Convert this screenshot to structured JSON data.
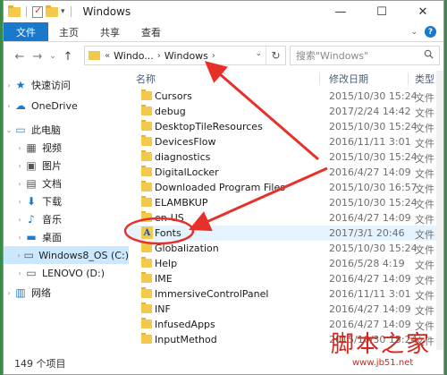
{
  "window": {
    "title": "Windows"
  },
  "ribbon": {
    "tabs": [
      {
        "label": "文件",
        "active": true
      },
      {
        "label": "主页",
        "active": false
      },
      {
        "label": "共享",
        "active": false
      },
      {
        "label": "查看",
        "active": false
      }
    ]
  },
  "address": {
    "prefix": "«",
    "segments": [
      "Windo...",
      "Windows"
    ],
    "search_placeholder": "搜索\"Windows\""
  },
  "nav": {
    "items": [
      {
        "label": "快速访问",
        "icon": "star-icon"
      },
      {
        "label": "OneDrive",
        "icon": "cloud-icon"
      },
      {
        "label": "此电脑",
        "icon": "computer-icon"
      },
      {
        "label": "视频",
        "icon": "video-icon"
      },
      {
        "label": "图片",
        "icon": "picture-icon"
      },
      {
        "label": "文档",
        "icon": "document-icon"
      },
      {
        "label": "下载",
        "icon": "download-icon"
      },
      {
        "label": "音乐",
        "icon": "music-icon"
      },
      {
        "label": "桌面",
        "icon": "desktop-icon"
      },
      {
        "label": "Windows8_OS (C:)",
        "icon": "drive-c-icon",
        "selected": true
      },
      {
        "label": "LENOVO (D:)",
        "icon": "drive-d-icon"
      },
      {
        "label": "网络",
        "icon": "network-icon"
      }
    ]
  },
  "columns": {
    "name": "名称",
    "date": "修改日期",
    "type": "类型"
  },
  "files": [
    {
      "name": "Cursors",
      "date": "2015/10/30 15:24",
      "type": "文件"
    },
    {
      "name": "debug",
      "date": "2017/2/24 14:42",
      "type": "文件"
    },
    {
      "name": "DesktopTileResources",
      "date": "2015/10/30 15:24",
      "type": "文件"
    },
    {
      "name": "DevicesFlow",
      "date": "2016/11/11 3:01",
      "type": "文件"
    },
    {
      "name": "diagnostics",
      "date": "2015/10/30 15:24",
      "type": "文件"
    },
    {
      "name": "DigitalLocker",
      "date": "2016/4/27 14:09",
      "type": "文件"
    },
    {
      "name": "Downloaded Program Files",
      "date": "2015/10/30 16:57",
      "type": "文件"
    },
    {
      "name": "ELAMBKUP",
      "date": "2015/10/30 15:24",
      "type": "文件"
    },
    {
      "name": "en-US",
      "date": "2016/4/27 14:09",
      "type": "文件"
    },
    {
      "name": "Fonts",
      "date": "2017/3/1 20:46",
      "type": "文件",
      "highlight": true
    },
    {
      "name": "Globalization",
      "date": "2015/10/30 15:24",
      "type": "文件"
    },
    {
      "name": "Help",
      "date": "2016/5/28 4:19",
      "type": "文件"
    },
    {
      "name": "IME",
      "date": "2016/4/27 14:09",
      "type": "文件"
    },
    {
      "name": "ImmersiveControlPanel",
      "date": "2016/11/11 3:01",
      "type": "文件"
    },
    {
      "name": "INF",
      "date": "2016/4/27 14:09",
      "type": "文件"
    },
    {
      "name": "InfusedApps",
      "date": "2016/4/27 14:09",
      "type": "文件"
    },
    {
      "name": "InputMethod",
      "date": "2015/10/30 15:24",
      "type": "文件"
    }
  ],
  "status": {
    "count": "149 个项目"
  },
  "watermark": {
    "text": "脚本之家",
    "url": "www.jb51.net"
  },
  "colors": {
    "accent": "#1979ca",
    "annotation": "#e8302a",
    "selection": "#cce8ff"
  }
}
